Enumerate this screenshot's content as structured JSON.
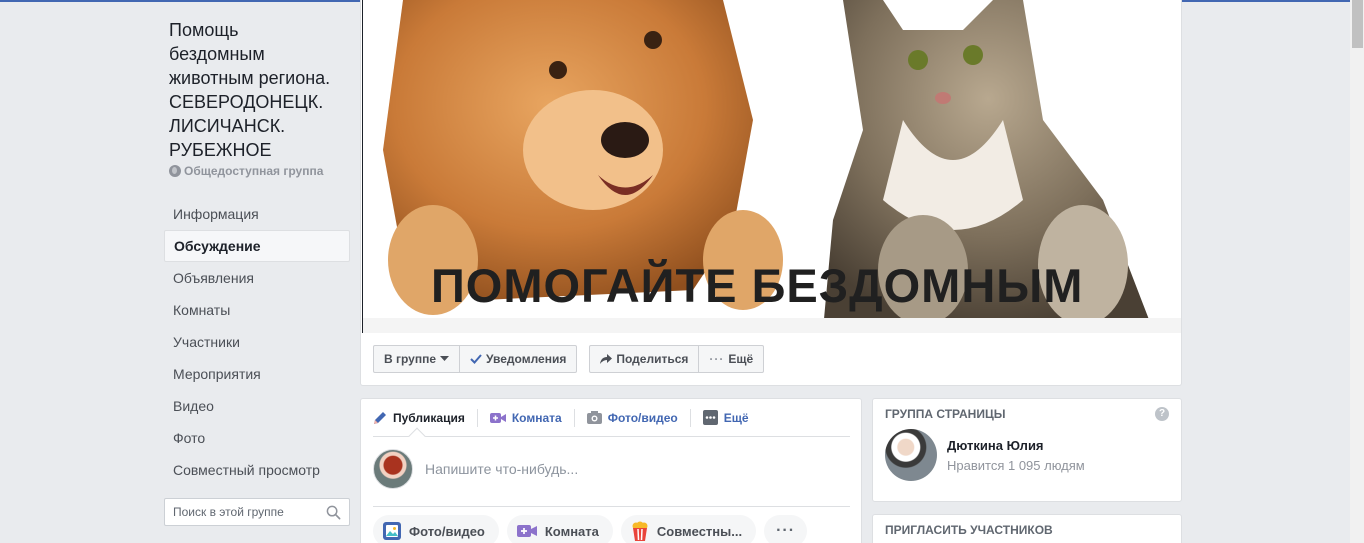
{
  "group": {
    "title_lines": [
      "Помощь",
      "бездомным",
      "животным региона.",
      "СЕВЕРОДОНЕЦК.",
      "ЛИСИЧАНСК.",
      "РУБЕЖНОЕ"
    ],
    "privacy": "Общедоступная группа"
  },
  "nav": {
    "items": [
      {
        "label": "Информация"
      },
      {
        "label": "Обсуждение"
      },
      {
        "label": "Объявления"
      },
      {
        "label": "Комнаты"
      },
      {
        "label": "Участники"
      },
      {
        "label": "Мероприятия"
      },
      {
        "label": "Видео"
      },
      {
        "label": "Фото"
      },
      {
        "label": "Совместный просмотр"
      }
    ],
    "active_index": 1
  },
  "search": {
    "placeholder": "Поиск в этой группе"
  },
  "cover": {
    "text": "ПОМОГАЙТЕ БЕЗДОМНЫМ"
  },
  "actions": {
    "in_group": "В группе",
    "notifications": "Уведомления",
    "share": "Поделиться",
    "more": "Ещё"
  },
  "composer": {
    "tabs": [
      "Публикация",
      "Комната",
      "Фото/видео",
      "Ещё"
    ],
    "placeholder": "Напишите что-нибудь...",
    "chips": [
      "Фото/видео",
      "Комната",
      "Совместны..."
    ]
  },
  "group_page": {
    "heading": "ГРУППА СТРАНИЦЫ",
    "name": "Дюткина Юлия",
    "likes": "Нравится 1 095 людям"
  },
  "invite": {
    "heading": "ПРИГЛАСИТЬ УЧАСТНИКОВ"
  },
  "colors": {
    "accent": "#4267b2",
    "background": "#e9ebee"
  }
}
